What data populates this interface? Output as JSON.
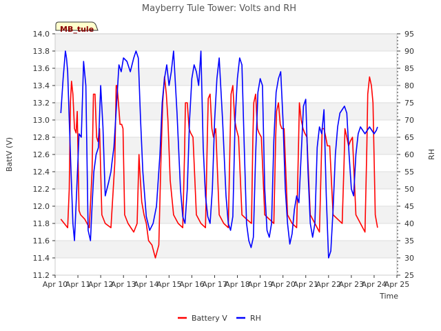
{
  "chart_data": {
    "type": "line",
    "title": "Mayberry Tule Tower: Volts and RH",
    "station_label": "MB_tule",
    "xlabel": "Time",
    "ylabel": "BattV (V)",
    "y2label": "RH",
    "x_ticks": [
      "Apr 10",
      "Apr 11",
      "Apr 12",
      "Apr 13",
      "Apr 14",
      "Apr 15",
      "Apr 16",
      "Apr 17",
      "Apr 18",
      "Apr 19",
      "Apr 20",
      "Apr 21",
      "Apr 22",
      "Apr 23",
      "Apr 24",
      "Apr 25"
    ],
    "xlim": [
      0,
      15
    ],
    "ylim": [
      11.2,
      14.0
    ],
    "y_ticks": [
      "11.2",
      "11.4",
      "11.6",
      "11.8",
      "12.0",
      "12.2",
      "12.4",
      "12.6",
      "12.8",
      "13.0",
      "13.2",
      "13.4",
      "13.6",
      "13.8",
      "14.0"
    ],
    "y2lim": [
      25,
      95
    ],
    "y2_ticks": [
      "25",
      "30",
      "35",
      "40",
      "45",
      "50",
      "55",
      "60",
      "65",
      "70",
      "75",
      "80",
      "85",
      "90",
      "95"
    ],
    "grid": true,
    "legend_position": "bottom",
    "series": [
      {
        "name": "Battery V",
        "axis": "left",
        "color": "#ff0000",
        "x": [
          0.25,
          0.4,
          0.55,
          0.62,
          0.67,
          0.72,
          0.78,
          0.85,
          0.92,
          0.97,
          1.05,
          1.12,
          1.3,
          1.5,
          1.62,
          1.68,
          1.75,
          1.82,
          1.88,
          1.95,
          2.05,
          2.2,
          2.45,
          2.62,
          2.68,
          2.72,
          2.78,
          2.85,
          2.92,
          2.98,
          3.05,
          3.2,
          3.45,
          3.6,
          3.68,
          3.72,
          3.8,
          3.9,
          4.0,
          4.1,
          4.25,
          4.4,
          4.55,
          4.62,
          4.65,
          4.72,
          4.8,
          4.88,
          4.95,
          5.05,
          5.2,
          5.4,
          5.6,
          5.68,
          5.72,
          5.8,
          5.88,
          5.95,
          6.05,
          6.2,
          6.4,
          6.6,
          6.68,
          6.72,
          6.8,
          6.88,
          6.95,
          7.05,
          7.2,
          7.4,
          7.6,
          7.68,
          7.72,
          7.8,
          7.88,
          7.95,
          8.05,
          8.2,
          8.4,
          8.62,
          8.68,
          8.72,
          8.8,
          8.88,
          8.95,
          9.05,
          9.2,
          9.4,
          9.6,
          9.68,
          9.72,
          9.8,
          9.88,
          9.95,
          10.05,
          10.2,
          10.4,
          10.6,
          10.68,
          10.72,
          10.8,
          10.88,
          10.95,
          11.05,
          11.2,
          11.4,
          11.6,
          11.68,
          11.72,
          11.8,
          11.88,
          11.95,
          12.05,
          12.2,
          12.4,
          12.6,
          12.68,
          12.72,
          12.8,
          12.88,
          12.95,
          13.05,
          13.2,
          13.4,
          13.6,
          13.68,
          13.72,
          13.8,
          13.88,
          13.95,
          14.05,
          14.15
        ],
        "y": [
          11.85,
          11.8,
          11.75,
          12.2,
          13.2,
          13.45,
          13.3,
          12.9,
          12.85,
          13.1,
          11.95,
          11.9,
          11.85,
          11.75,
          12.4,
          13.3,
          13.3,
          12.8,
          12.75,
          12.9,
          11.9,
          11.8,
          11.75,
          12.5,
          13.4,
          13.4,
          13.2,
          12.95,
          12.95,
          12.9,
          11.9,
          11.8,
          11.7,
          11.8,
          12.6,
          12.4,
          12.05,
          11.9,
          11.8,
          11.6,
          11.55,
          11.4,
          11.55,
          12.3,
          12.6,
          13.2,
          13.5,
          13.3,
          13.0,
          12.3,
          11.9,
          11.8,
          11.75,
          12.6,
          13.2,
          13.2,
          12.9,
          12.85,
          12.8,
          11.9,
          11.8,
          11.75,
          12.8,
          13.25,
          13.3,
          12.9,
          12.8,
          12.9,
          11.9,
          11.8,
          11.75,
          12.8,
          13.3,
          13.4,
          13.0,
          12.9,
          12.8,
          11.9,
          11.85,
          11.8,
          12.8,
          13.2,
          13.3,
          12.9,
          12.85,
          12.8,
          11.9,
          11.85,
          11.8,
          12.8,
          13.1,
          13.2,
          12.95,
          12.9,
          12.9,
          11.9,
          11.8,
          11.75,
          12.7,
          13.2,
          13.0,
          12.9,
          12.85,
          12.8,
          11.9,
          11.8,
          11.7,
          12.5,
          12.9,
          12.9,
          12.8,
          12.7,
          12.7,
          11.9,
          11.85,
          11.8,
          12.5,
          12.9,
          12.8,
          12.7,
          12.75,
          12.8,
          11.9,
          11.8,
          11.7,
          12.7,
          13.3,
          13.5,
          13.4,
          13.2,
          11.9,
          11.75
        ],
        "values": [
          11.85,
          11.8,
          11.75,
          12.2,
          13.2,
          13.45,
          13.3,
          12.9,
          12.85,
          13.1,
          11.95,
          11.9,
          11.85,
          11.75,
          12.4,
          13.3,
          13.3,
          12.8,
          12.75,
          12.9,
          11.9,
          11.8,
          11.75,
          12.5,
          13.4,
          13.4,
          13.2,
          12.95,
          12.95,
          12.9,
          11.9,
          11.8,
          11.7,
          11.8,
          12.6,
          12.4,
          12.05,
          11.9,
          11.8,
          11.6,
          11.55,
          11.4,
          11.55,
          12.3,
          12.6,
          13.2,
          13.5,
          13.3,
          13.0,
          12.3,
          11.9,
          11.8,
          11.75,
          12.6,
          13.2,
          13.2,
          12.9,
          12.85,
          12.8,
          11.9,
          11.8,
          11.75,
          12.8,
          13.25,
          13.3,
          12.9,
          12.8,
          12.9,
          11.9,
          11.8,
          11.75,
          12.8,
          13.3,
          13.4,
          13.0,
          12.9,
          12.8,
          11.9,
          11.85,
          11.8,
          12.8,
          13.2,
          13.3,
          12.9,
          12.85,
          12.8,
          11.9,
          11.85,
          11.8,
          12.8,
          13.1,
          13.2,
          12.95,
          12.9,
          12.9,
          11.9,
          11.8,
          11.75,
          12.7,
          13.2,
          13.0,
          12.9,
          12.85,
          12.8,
          11.9,
          11.8,
          11.7,
          12.5,
          12.9,
          12.9,
          12.8,
          12.7,
          12.7,
          11.9,
          11.85,
          11.8,
          12.5,
          12.9,
          12.8,
          12.7,
          12.75,
          12.8,
          11.9,
          11.8,
          11.7,
          12.7,
          13.3,
          13.5,
          13.4,
          13.2,
          11.9,
          11.75
        ]
      },
      {
        "name": "RH",
        "axis": "right",
        "color": "#0000ff",
        "x": [
          0.25,
          0.35,
          0.45,
          0.5,
          0.55,
          0.62,
          0.7,
          0.78,
          0.85,
          0.95,
          1.05,
          1.15,
          1.25,
          1.35,
          1.45,
          1.55,
          1.62,
          1.7,
          1.8,
          1.9,
          2.0,
          2.1,
          2.2,
          2.35,
          2.45,
          2.5,
          2.58,
          2.7,
          2.8,
          2.9,
          3.0,
          3.15,
          3.3,
          3.45,
          3.55,
          3.65,
          3.75,
          3.85,
          4.0,
          4.15,
          4.3,
          4.45,
          4.6,
          4.7,
          4.8,
          4.9,
          5.0,
          5.1,
          5.2,
          5.35,
          5.5,
          5.6,
          5.7,
          5.8,
          5.9,
          6.0,
          6.1,
          6.2,
          6.3,
          6.4,
          6.5,
          6.6,
          6.7,
          6.8,
          6.9,
          7.0,
          7.1,
          7.2,
          7.35,
          7.5,
          7.6,
          7.7,
          7.8,
          7.9,
          8.0,
          8.1,
          8.2,
          8.3,
          8.4,
          8.5,
          8.6,
          8.7,
          8.8,
          8.9,
          9.0,
          9.1,
          9.2,
          9.3,
          9.4,
          9.5,
          9.6,
          9.7,
          9.8,
          9.9,
          10.0,
          10.1,
          10.2,
          10.3,
          10.4,
          10.5,
          10.6,
          10.7,
          10.8,
          10.9,
          11.0,
          11.1,
          11.2,
          11.3,
          11.4,
          11.5,
          11.6,
          11.7,
          11.8,
          11.9,
          12.0,
          12.1,
          12.2,
          12.3,
          12.4,
          12.5,
          12.6,
          12.7,
          12.8,
          12.9,
          13.0,
          13.1,
          13.2,
          13.3,
          13.4,
          13.5,
          13.6,
          13.7,
          13.8,
          13.9,
          14.0,
          14.1,
          14.15
        ],
        "y": [
          72,
          82,
          90,
          88,
          84,
          70,
          55,
          40,
          35,
          50,
          66,
          65,
          87,
          80,
          38,
          35,
          45,
          55,
          60,
          62,
          80,
          68,
          48,
          52,
          55,
          58,
          62,
          75,
          86,
          84,
          88,
          87,
          84,
          88,
          90,
          88,
          70,
          55,
          42,
          38,
          40,
          45,
          60,
          75,
          82,
          86,
          80,
          84,
          90,
          72,
          50,
          42,
          40,
          50,
          70,
          82,
          86,
          84,
          80,
          90,
          62,
          48,
          42,
          40,
          50,
          70,
          82,
          88,
          70,
          48,
          40,
          38,
          42,
          70,
          82,
          88,
          86,
          62,
          40,
          35,
          33,
          36,
          60,
          78,
          82,
          80,
          50,
          38,
          36,
          40,
          64,
          78,
          82,
          84,
          70,
          50,
          40,
          34,
          37,
          44,
          48,
          46,
          60,
          74,
          76,
          55,
          40,
          36,
          40,
          62,
          68,
          66,
          73,
          48,
          30,
          32,
          44,
          60,
          68,
          72,
          73,
          74,
          72,
          60,
          50,
          48,
          60,
          66,
          68,
          67,
          66,
          67,
          68,
          67,
          66,
          67,
          68
        ],
        "values": [
          72,
          82,
          90,
          88,
          84,
          70,
          55,
          40,
          35,
          50,
          66,
          65,
          87,
          80,
          38,
          35,
          45,
          55,
          60,
          62,
          80,
          68,
          48,
          52,
          55,
          58,
          62,
          75,
          86,
          84,
          88,
          87,
          84,
          88,
          90,
          88,
          70,
          55,
          42,
          38,
          40,
          45,
          60,
          75,
          82,
          86,
          80,
          84,
          90,
          72,
          50,
          42,
          40,
          50,
          70,
          82,
          86,
          84,
          80,
          90,
          62,
          48,
          42,
          40,
          50,
          70,
          82,
          88,
          70,
          48,
          40,
          38,
          42,
          70,
          82,
          88,
          86,
          62,
          40,
          35,
          33,
          36,
          60,
          78,
          82,
          80,
          50,
          38,
          36,
          40,
          64,
          78,
          82,
          84,
          70,
          50,
          40,
          34,
          37,
          44,
          48,
          46,
          60,
          74,
          76,
          55,
          40,
          36,
          40,
          62,
          68,
          66,
          73,
          48,
          30,
          32,
          44,
          60,
          68,
          72,
          73,
          74,
          72,
          60,
          50,
          48,
          60,
          66,
          68,
          67,
          66,
          67,
          68,
          67,
          66,
          67,
          68
        ]
      }
    ]
  }
}
